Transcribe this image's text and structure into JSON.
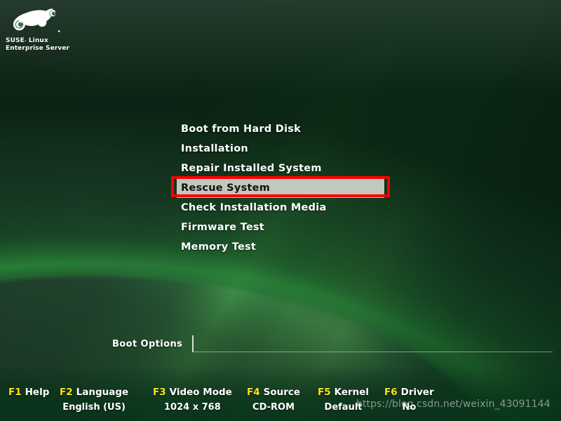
{
  "branding": {
    "logo_icon": "suse-chameleon-logo",
    "line1": "SUSE",
    "registered": ".",
    "line1_rest": " Linux",
    "line2": "Enterprise Server",
    "full_name": "SUSE. Linux Enterprise Server"
  },
  "menu": {
    "selected_index": 3,
    "items": [
      {
        "label": "Boot from Hard Disk",
        "selected": false
      },
      {
        "label": "Installation",
        "selected": false
      },
      {
        "label": "Repair Installed System",
        "selected": false
      },
      {
        "label": "Rescue System",
        "selected": true
      },
      {
        "label": "Check Installation Media",
        "selected": false
      },
      {
        "label": "Firmware Test",
        "selected": false
      },
      {
        "label": "Memory Test",
        "selected": false
      }
    ]
  },
  "boot_options": {
    "label": "Boot Options",
    "value": "",
    "placeholder": ""
  },
  "function_keys": [
    {
      "key": "F1",
      "name": "Help",
      "value": ""
    },
    {
      "key": "F2",
      "name": "Language",
      "value": "English (US)"
    },
    {
      "key": "F3",
      "name": "Video Mode",
      "value": "1024 x 768"
    },
    {
      "key": "F4",
      "name": "Source",
      "value": "CD-ROM"
    },
    {
      "key": "F5",
      "name": "Kernel",
      "value": "Default"
    },
    {
      "key": "F6",
      "name": "Driver",
      "value": "No"
    }
  ],
  "watermark": {
    "text": "https://blog.csdn.net/weixin_43091144"
  },
  "colors": {
    "background_dark_green": "#123d22",
    "background_mid_green": "#2b5139",
    "background_bright_green": "#5ccc60",
    "background_grey_green": "#687c70",
    "selection_highlight": "#c3c8bf",
    "selection_text": "#111111",
    "annotation_red": "#fb0000",
    "fkey_yellow": "#ffe215",
    "text_white": "#ffffff"
  }
}
